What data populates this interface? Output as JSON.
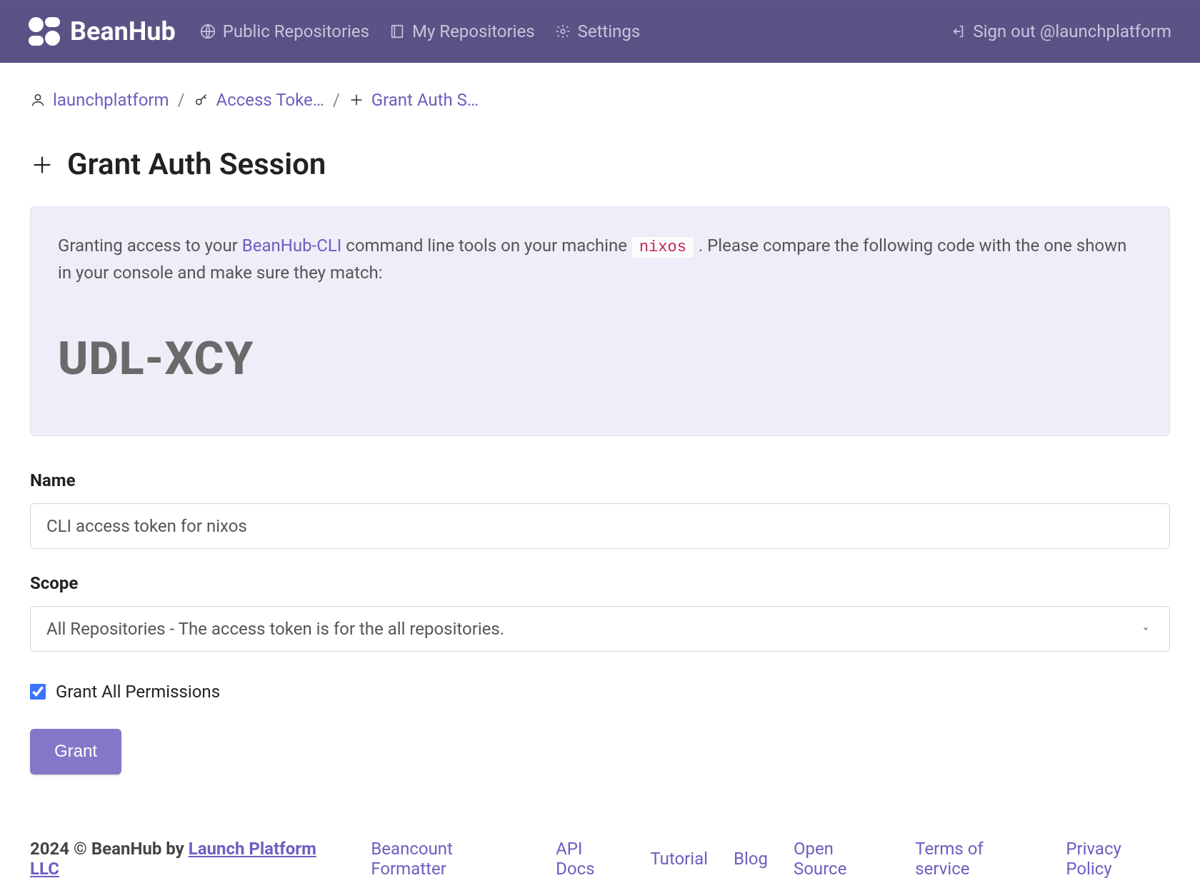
{
  "brand": {
    "name": "BeanHub"
  },
  "nav": {
    "public_repos": "Public Repositories",
    "my_repos": "My Repositories",
    "settings": "Settings",
    "signout": "Sign out @launchplatform"
  },
  "breadcrumb": {
    "user": "launchplatform",
    "tokens": "Access Toke…",
    "grant": "Grant Auth S…"
  },
  "page": {
    "title": "Grant Auth Session"
  },
  "card": {
    "prefix": "Granting access to your ",
    "cli_link": "BeanHub-CLI",
    "mid1": " command line tools on your machine ",
    "machine": "nixos",
    "mid2": " . Please compare the following code with the one shown in your console and make sure they match:",
    "code": "UDL-XCY"
  },
  "form": {
    "name_label": "Name",
    "name_value": "CLI access token for nixos",
    "scope_label": "Scope",
    "scope_value": "All Repositories - The access token is for the all repositories.",
    "grant_all_label": "Grant All Permissions",
    "grant_btn": "Grant"
  },
  "footer": {
    "copyright": "2024 © BeanHub by  ",
    "company": "Launch Platform LLC",
    "links": {
      "formatter": "Beancount Formatter",
      "api": "API Docs",
      "tutorial": "Tutorial",
      "blog": "Blog",
      "opensource": "Open Source",
      "tos": "Terms of service",
      "privacy": "Privacy Policy"
    }
  }
}
